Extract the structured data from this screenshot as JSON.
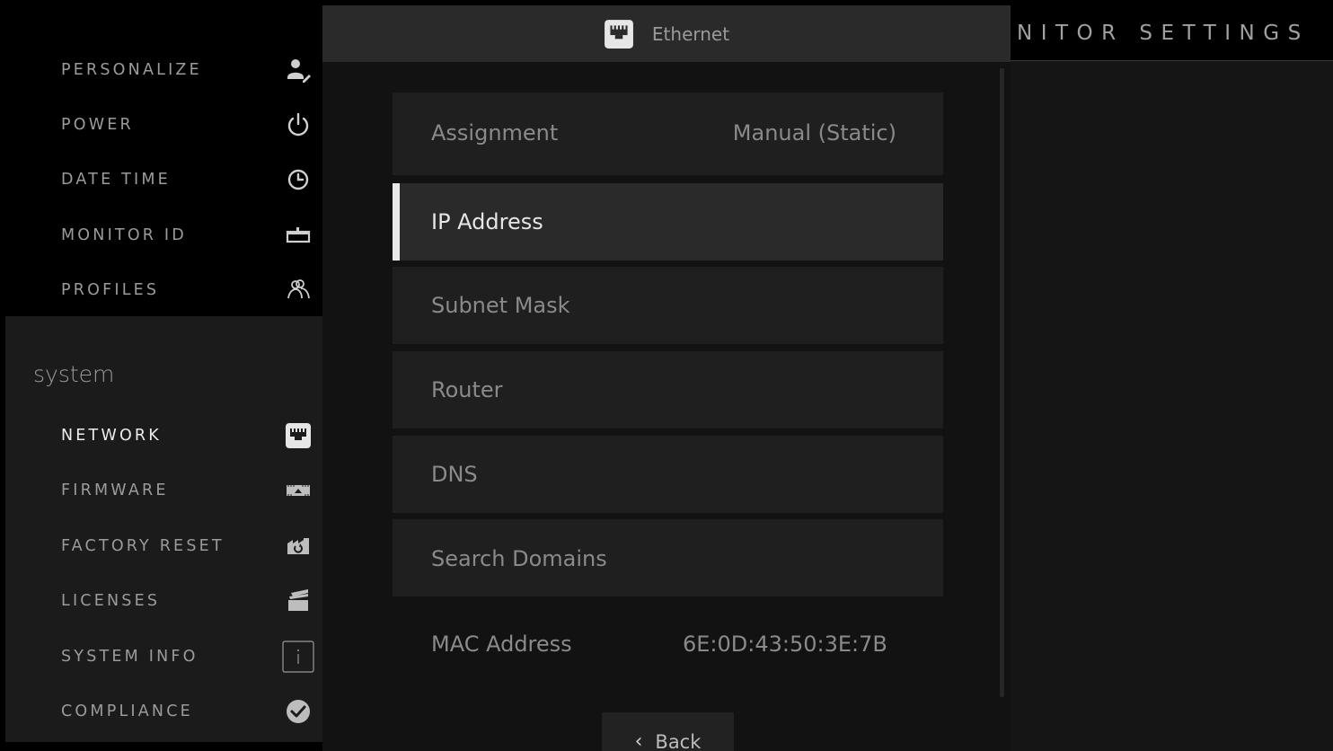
{
  "sidebar": {
    "top_items": [
      {
        "label": "PERSONALIZE",
        "icon": "person-edit-icon"
      },
      {
        "label": "POWER",
        "icon": "power-icon"
      },
      {
        "label": "DATE TIME",
        "icon": "clock-icon"
      },
      {
        "label": "MONITOR ID",
        "icon": "monitor-id-icon"
      },
      {
        "label": "PROFILES",
        "icon": "profiles-icon"
      }
    ],
    "section_title": "system",
    "system_items": [
      {
        "label": "NETWORK",
        "icon": "ethernet-icon",
        "active": true
      },
      {
        "label": "FIRMWARE",
        "icon": "firmware-icon"
      },
      {
        "label": "FACTORY RESET",
        "icon": "factory-reset-icon"
      },
      {
        "label": "LICENSES",
        "icon": "licenses-icon"
      },
      {
        "label": "SYSTEM INFO",
        "icon": "info-icon"
      },
      {
        "label": "COMPLIANCE",
        "icon": "check-circle-icon"
      }
    ]
  },
  "center": {
    "header_title": "Ethernet",
    "header_icon": "ethernet-icon",
    "rows": [
      {
        "label": "Assignment",
        "value": "Manual (Static)"
      },
      {
        "label": "IP Address",
        "value": ""
      },
      {
        "label": "Subnet Mask",
        "value": ""
      },
      {
        "label": "Router",
        "value": ""
      },
      {
        "label": "DNS",
        "value": ""
      },
      {
        "label": "Search Domains",
        "value": ""
      }
    ],
    "mac": {
      "label": "MAC Address",
      "value": "6E:0D:43:50:3E:7B"
    },
    "back_label": "Back"
  },
  "right": {
    "title": "NITOR SETTINGS"
  },
  "colors": {
    "background": "#000000",
    "panel": "#1f1f1f",
    "active_row": "#2a2a2a",
    "accent": "#e8e8e8"
  }
}
